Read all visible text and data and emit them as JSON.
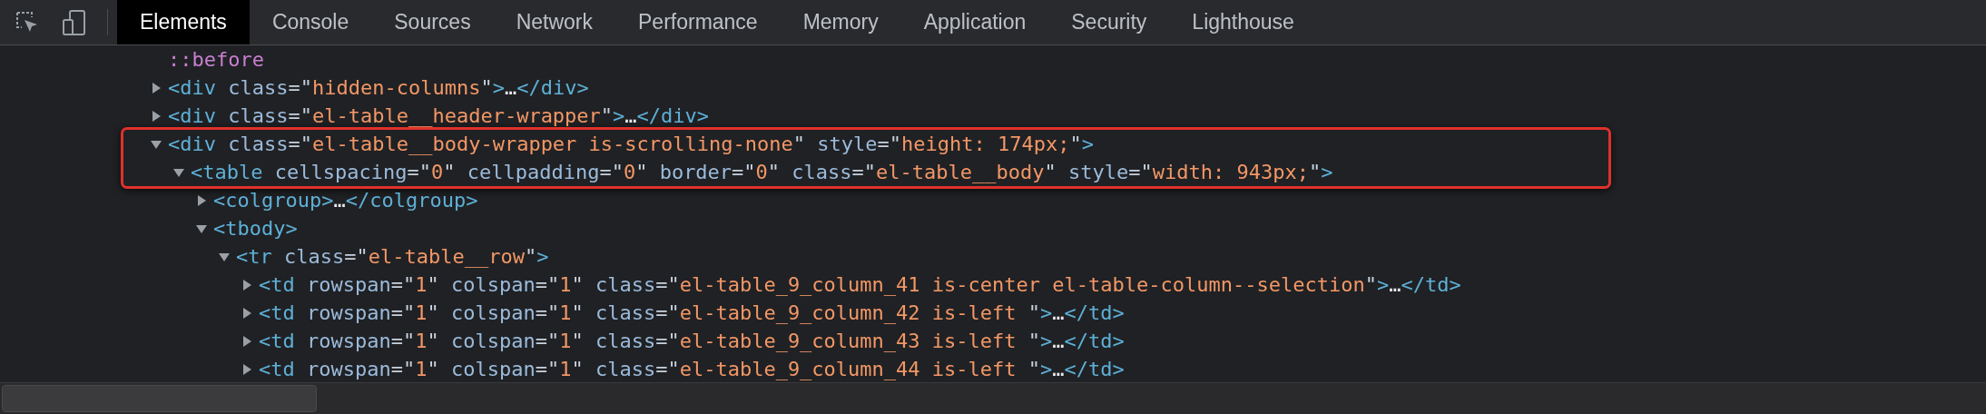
{
  "toolbar": {
    "tools": [
      {
        "kind": "inspect"
      },
      {
        "kind": "device"
      }
    ]
  },
  "tabs": [
    {
      "label": "Elements",
      "selected": true
    },
    {
      "label": "Console",
      "selected": false
    },
    {
      "label": "Sources",
      "selected": false
    },
    {
      "label": "Network",
      "selected": false
    },
    {
      "label": "Performance",
      "selected": false
    },
    {
      "label": "Memory",
      "selected": false
    },
    {
      "label": "Application",
      "selected": false
    },
    {
      "label": "Security",
      "selected": false
    },
    {
      "label": "Lighthouse",
      "selected": false
    }
  ],
  "dom_tree": [
    {
      "kind": "pseudo",
      "tokens": [
        {
          "kind": "pseudo",
          "text": "::before"
        }
      ]
    },
    {
      "kind": "element",
      "expanded": false,
      "boxed": false,
      "tokens": [
        {
          "kind": "tag",
          "text": "<div"
        },
        {
          "kind": "attr",
          "text": " class"
        },
        {
          "kind": "punct",
          "text": "=\""
        },
        {
          "kind": "value",
          "text": "hidden-columns"
        },
        {
          "kind": "punct",
          "text": "\""
        },
        {
          "kind": "tag",
          "text": ">"
        },
        {
          "kind": "ellipsis",
          "text": "…"
        },
        {
          "kind": "tag",
          "text": "</div>"
        }
      ]
    },
    {
      "kind": "element",
      "expanded": false,
      "boxed": false,
      "tokens": [
        {
          "kind": "tag",
          "text": "<div"
        },
        {
          "kind": "attr",
          "text": " class"
        },
        {
          "kind": "punct",
          "text": "=\""
        },
        {
          "kind": "value",
          "text": "el-table__header-wrapper"
        },
        {
          "kind": "punct",
          "text": "\""
        },
        {
          "kind": "tag",
          "text": ">"
        },
        {
          "kind": "ellipsis",
          "text": "…"
        },
        {
          "kind": "tag",
          "text": "</div>"
        }
      ]
    },
    {
      "kind": "element",
      "expanded": true,
      "boxed": true,
      "tokens": [
        {
          "kind": "tag",
          "text": "<div"
        },
        {
          "kind": "attr",
          "text": " class"
        },
        {
          "kind": "punct",
          "text": "=\""
        },
        {
          "kind": "value",
          "text": "el-table__body-wrapper is-scrolling-none"
        },
        {
          "kind": "punct",
          "text": "\""
        },
        {
          "kind": "attr",
          "text": " style"
        },
        {
          "kind": "punct",
          "text": "=\""
        },
        {
          "kind": "value",
          "text": "height: 174px;"
        },
        {
          "kind": "punct",
          "text": "\""
        },
        {
          "kind": "tag",
          "text": ">"
        }
      ],
      "children": [
        {
          "kind": "element",
          "expanded": true,
          "boxed": true,
          "tokens": [
            {
              "kind": "tag",
              "text": "<table"
            },
            {
              "kind": "attr",
              "text": " cellspacing"
            },
            {
              "kind": "punct",
              "text": "=\""
            },
            {
              "kind": "value",
              "text": "0"
            },
            {
              "kind": "punct",
              "text": "\""
            },
            {
              "kind": "attr",
              "text": " cellpadding"
            },
            {
              "kind": "punct",
              "text": "=\""
            },
            {
              "kind": "value",
              "text": "0"
            },
            {
              "kind": "punct",
              "text": "\""
            },
            {
              "kind": "attr",
              "text": " border"
            },
            {
              "kind": "punct",
              "text": "=\""
            },
            {
              "kind": "value",
              "text": "0"
            },
            {
              "kind": "punct",
              "text": "\""
            },
            {
              "kind": "attr",
              "text": " class"
            },
            {
              "kind": "punct",
              "text": "=\""
            },
            {
              "kind": "value",
              "text": "el-table__body"
            },
            {
              "kind": "punct",
              "text": "\""
            },
            {
              "kind": "attr",
              "text": " style"
            },
            {
              "kind": "punct",
              "text": "=\""
            },
            {
              "kind": "value",
              "text": "width: 943px;"
            },
            {
              "kind": "punct",
              "text": "\""
            },
            {
              "kind": "tag",
              "text": ">"
            }
          ],
          "children": [
            {
              "kind": "element",
              "expanded": false,
              "boxed": false,
              "tokens": [
                {
                  "kind": "tag",
                  "text": "<colgroup>"
                },
                {
                  "kind": "ellipsis",
                  "text": "…"
                },
                {
                  "kind": "tag",
                  "text": "</colgroup>"
                }
              ]
            },
            {
              "kind": "element",
              "expanded": true,
              "boxed": false,
              "tokens": [
                {
                  "kind": "tag",
                  "text": "<tbody>"
                }
              ],
              "children": [
                {
                  "kind": "element",
                  "expanded": true,
                  "boxed": false,
                  "tokens": [
                    {
                      "kind": "tag",
                      "text": "<tr"
                    },
                    {
                      "kind": "attr",
                      "text": " class"
                    },
                    {
                      "kind": "punct",
                      "text": "=\""
                    },
                    {
                      "kind": "value",
                      "text": "el-table__row"
                    },
                    {
                      "kind": "punct",
                      "text": "\""
                    },
                    {
                      "kind": "tag",
                      "text": ">"
                    }
                  ],
                  "children": [
                    {
                      "kind": "element",
                      "expanded": false,
                      "boxed": false,
                      "tokens": [
                        {
                          "kind": "tag",
                          "text": "<td"
                        },
                        {
                          "kind": "attr",
                          "text": " rowspan"
                        },
                        {
                          "kind": "punct",
                          "text": "=\""
                        },
                        {
                          "kind": "value",
                          "text": "1"
                        },
                        {
                          "kind": "punct",
                          "text": "\""
                        },
                        {
                          "kind": "attr",
                          "text": " colspan"
                        },
                        {
                          "kind": "punct",
                          "text": "=\""
                        },
                        {
                          "kind": "value",
                          "text": "1"
                        },
                        {
                          "kind": "punct",
                          "text": "\""
                        },
                        {
                          "kind": "attr",
                          "text": " class"
                        },
                        {
                          "kind": "punct",
                          "text": "=\""
                        },
                        {
                          "kind": "value",
                          "text": "el-table_9_column_41 is-center el-table-column--selection"
                        },
                        {
                          "kind": "punct",
                          "text": "\""
                        },
                        {
                          "kind": "tag",
                          "text": ">"
                        },
                        {
                          "kind": "ellipsis",
                          "text": "…"
                        },
                        {
                          "kind": "tag",
                          "text": "</td>"
                        }
                      ]
                    },
                    {
                      "kind": "element",
                      "expanded": false,
                      "boxed": false,
                      "tokens": [
                        {
                          "kind": "tag",
                          "text": "<td"
                        },
                        {
                          "kind": "attr",
                          "text": " rowspan"
                        },
                        {
                          "kind": "punct",
                          "text": "=\""
                        },
                        {
                          "kind": "value",
                          "text": "1"
                        },
                        {
                          "kind": "punct",
                          "text": "\""
                        },
                        {
                          "kind": "attr",
                          "text": " colspan"
                        },
                        {
                          "kind": "punct",
                          "text": "=\""
                        },
                        {
                          "kind": "value",
                          "text": "1"
                        },
                        {
                          "kind": "punct",
                          "text": "\""
                        },
                        {
                          "kind": "attr",
                          "text": " class"
                        },
                        {
                          "kind": "punct",
                          "text": "=\""
                        },
                        {
                          "kind": "value",
                          "text": "el-table_9_column_42 is-left "
                        },
                        {
                          "kind": "punct",
                          "text": "\""
                        },
                        {
                          "kind": "tag",
                          "text": ">"
                        },
                        {
                          "kind": "ellipsis",
                          "text": "…"
                        },
                        {
                          "kind": "tag",
                          "text": "</td>"
                        }
                      ]
                    },
                    {
                      "kind": "element",
                      "expanded": false,
                      "boxed": false,
                      "tokens": [
                        {
                          "kind": "tag",
                          "text": "<td"
                        },
                        {
                          "kind": "attr",
                          "text": " rowspan"
                        },
                        {
                          "kind": "punct",
                          "text": "=\""
                        },
                        {
                          "kind": "value",
                          "text": "1"
                        },
                        {
                          "kind": "punct",
                          "text": "\""
                        },
                        {
                          "kind": "attr",
                          "text": " colspan"
                        },
                        {
                          "kind": "punct",
                          "text": "=\""
                        },
                        {
                          "kind": "value",
                          "text": "1"
                        },
                        {
                          "kind": "punct",
                          "text": "\""
                        },
                        {
                          "kind": "attr",
                          "text": " class"
                        },
                        {
                          "kind": "punct",
                          "text": "=\""
                        },
                        {
                          "kind": "value",
                          "text": "el-table_9_column_43 is-left "
                        },
                        {
                          "kind": "punct",
                          "text": "\""
                        },
                        {
                          "kind": "tag",
                          "text": ">"
                        },
                        {
                          "kind": "ellipsis",
                          "text": "…"
                        },
                        {
                          "kind": "tag",
                          "text": "</td>"
                        }
                      ]
                    },
                    {
                      "kind": "element",
                      "expanded": false,
                      "boxed": false,
                      "tokens": [
                        {
                          "kind": "tag",
                          "text": "<td"
                        },
                        {
                          "kind": "attr",
                          "text": " rowspan"
                        },
                        {
                          "kind": "punct",
                          "text": "=\""
                        },
                        {
                          "kind": "value",
                          "text": "1"
                        },
                        {
                          "kind": "punct",
                          "text": "\""
                        },
                        {
                          "kind": "attr",
                          "text": " colspan"
                        },
                        {
                          "kind": "punct",
                          "text": "=\""
                        },
                        {
                          "kind": "value",
                          "text": "1"
                        },
                        {
                          "kind": "punct",
                          "text": "\""
                        },
                        {
                          "kind": "attr",
                          "text": " class"
                        },
                        {
                          "kind": "punct",
                          "text": "=\""
                        },
                        {
                          "kind": "value",
                          "text": "el-table_9_column_44 is-left "
                        },
                        {
                          "kind": "punct",
                          "text": "\""
                        },
                        {
                          "kind": "tag",
                          "text": ">"
                        },
                        {
                          "kind": "ellipsis",
                          "text": "…"
                        },
                        {
                          "kind": "tag",
                          "text": "</td>"
                        }
                      ]
                    }
                  ]
                }
              ]
            }
          ]
        }
      ]
    }
  ]
}
